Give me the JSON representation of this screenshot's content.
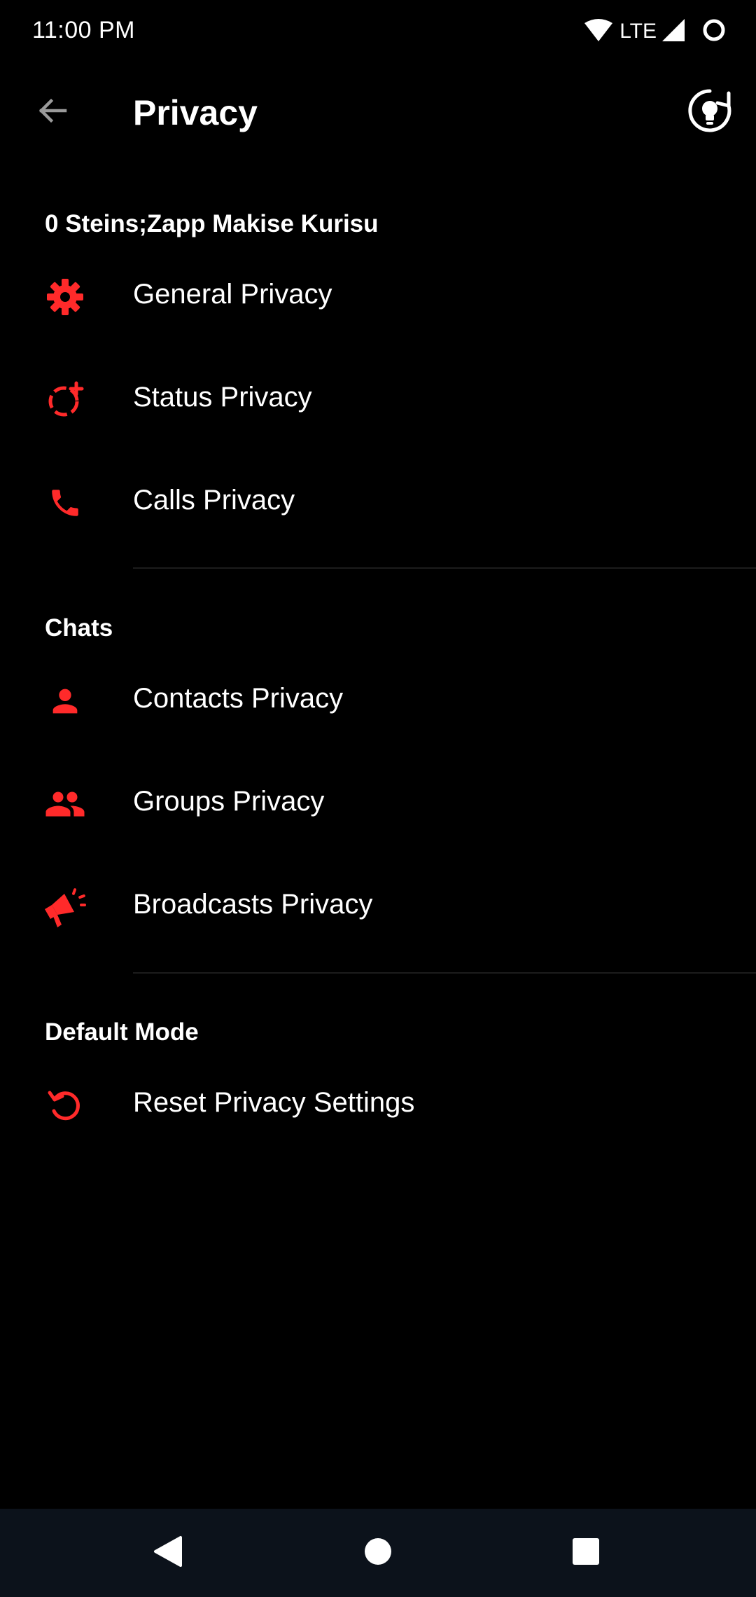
{
  "status_bar": {
    "time": "11:00 PM",
    "network": "LTE",
    "icons": [
      "wifi-icon",
      "signal-icon",
      "battery-ring-icon"
    ]
  },
  "app_bar": {
    "title": "Privacy",
    "back_icon": "arrow-left-icon",
    "action_icon": "lightbulb-refresh-icon"
  },
  "accent_color": "#ff2a2a",
  "sections": [
    {
      "header": "0 Steins;Zapp Makise Kurisu",
      "items": [
        {
          "label": "General Privacy",
          "icon": "gear-icon"
        },
        {
          "label": "Status Privacy",
          "icon": "status-add-icon"
        },
        {
          "label": "Calls Privacy",
          "icon": "phone-icon"
        }
      ]
    },
    {
      "header": "Chats",
      "items": [
        {
          "label": "Contacts Privacy",
          "icon": "person-icon"
        },
        {
          "label": "Groups Privacy",
          "icon": "group-icon"
        },
        {
          "label": "Broadcasts Privacy",
          "icon": "megaphone-icon"
        }
      ]
    },
    {
      "header": "Default Mode",
      "items": [
        {
          "label": "Reset Privacy Settings",
          "icon": "reset-icon"
        }
      ]
    }
  ],
  "nav_bar": {
    "buttons": [
      "back-triangle-icon",
      "home-circle-icon",
      "recents-square-icon"
    ]
  }
}
